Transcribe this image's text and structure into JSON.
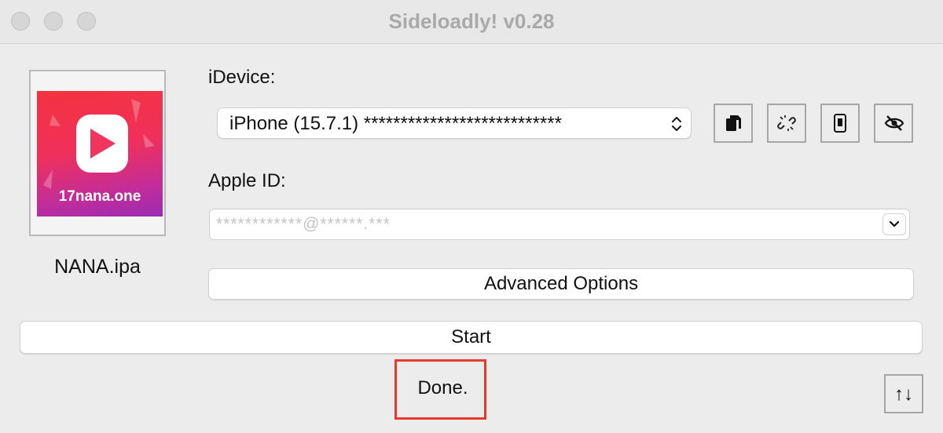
{
  "window": {
    "title": "Sideloadly! v0.28"
  },
  "app": {
    "icon_label": "17nana.one",
    "file_name": "NANA.ipa"
  },
  "idevice": {
    "label": "iDevice:",
    "selected": "iPhone (15.7.1) ***************************",
    "toolbar_icons": [
      "copy-icon",
      "unlink-icon",
      "phone-icon",
      "hide-icon"
    ]
  },
  "apple_id": {
    "label": "Apple ID:",
    "value": "************@******.***"
  },
  "buttons": {
    "advanced": "Advanced Options",
    "start": "Start",
    "sort_glyph": "↑↓"
  },
  "status": {
    "text": "Done."
  },
  "colors": {
    "status_highlight": "#e8392a",
    "window_bg": "#ececec",
    "title_text": "#a9a9a9"
  }
}
